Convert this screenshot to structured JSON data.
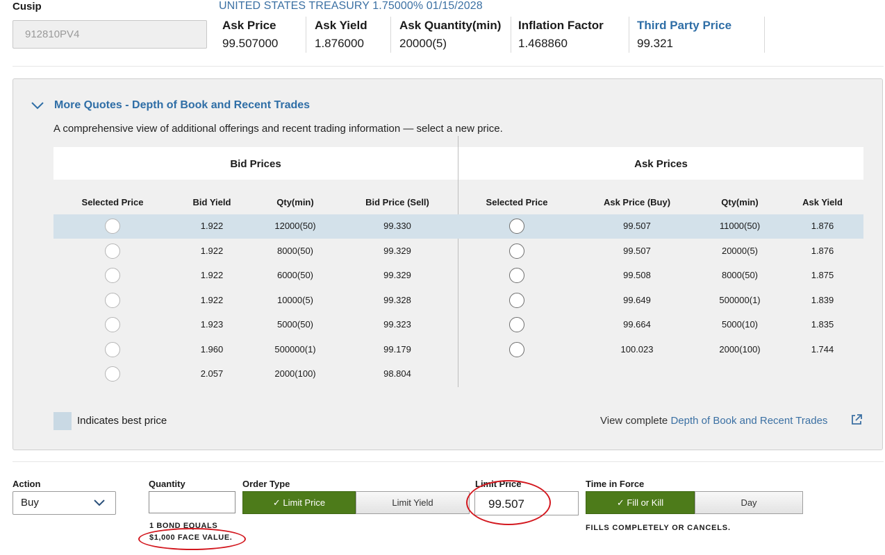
{
  "header": {
    "cusip_label": "Cusip",
    "cusip_value": "912810PV4",
    "security_title": "UNITED STATES TREASURY 1.75000% 01/15/2028",
    "quote_fields": [
      {
        "label": "Ask Price",
        "value": "99.507000"
      },
      {
        "label": "Ask Yield",
        "value": "1.876000"
      },
      {
        "label": "Ask Quantity(min)",
        "value": "20000(5)"
      },
      {
        "label": "Inflation Factor",
        "value": "1.468860"
      },
      {
        "label": "Third Party Price",
        "value": "99.321"
      }
    ]
  },
  "more_quotes": {
    "title": "More Quotes - Depth of Book and Recent Trades",
    "description": "A comprehensive view of additional offerings and recent trading information — select a new price.",
    "bid_group_label": "Bid Prices",
    "ask_group_label": "Ask Prices",
    "bid_columns": [
      "Selected Price",
      "Bid Yield",
      "Qty(min)",
      "Bid Price (Sell)"
    ],
    "ask_columns": [
      "Selected Price",
      "Ask Price (Buy)",
      "Qty(min)",
      "Ask Yield"
    ],
    "bid_rows": [
      {
        "yield": "1.922",
        "qty": "12000(50)",
        "price": "99.330"
      },
      {
        "yield": "1.922",
        "qty": "8000(50)",
        "price": "99.329"
      },
      {
        "yield": "1.922",
        "qty": "6000(50)",
        "price": "99.329"
      },
      {
        "yield": "1.922",
        "qty": "10000(5)",
        "price": "99.328"
      },
      {
        "yield": "1.923",
        "qty": "5000(50)",
        "price": "99.323"
      },
      {
        "yield": "1.960",
        "qty": "500000(1)",
        "price": "99.179"
      },
      {
        "yield": "2.057",
        "qty": "2000(100)",
        "price": "98.804"
      }
    ],
    "ask_rows": [
      {
        "price": "99.507",
        "qty": "11000(50)",
        "yield": "1.876"
      },
      {
        "price": "99.507",
        "qty": "20000(5)",
        "yield": "1.876"
      },
      {
        "price": "99.508",
        "qty": "8000(50)",
        "yield": "1.875"
      },
      {
        "price": "99.649",
        "qty": "500000(1)",
        "yield": "1.839"
      },
      {
        "price": "99.664",
        "qty": "5000(10)",
        "yield": "1.835"
      },
      {
        "price": "100.023",
        "qty": "2000(100)",
        "yield": "1.744"
      }
    ],
    "legend_text": "Indicates best price",
    "view_complete_prefix": "View complete ",
    "view_complete_link": "Depth of Book and Recent Trades"
  },
  "order": {
    "action_label": "Action",
    "action_value": "Buy",
    "quantity_label": "Quantity",
    "quantity_value": "",
    "quantity_note_line1": "1 BOND EQUALS",
    "quantity_note_line2": "$1,000 FACE VALUE.",
    "order_type_label": "Order Type",
    "order_type_options": [
      "Limit Price",
      "Limit Yield"
    ],
    "limit_price_label": "Limit Price",
    "limit_price_value": "99.507",
    "tif_label": "Time in Force",
    "tif_options": [
      "Fill or Kill",
      "Day"
    ],
    "tif_note": "FILLS COMPLETELY OR CANCELS."
  },
  "colors": {
    "link_blue": "#2f6ea6",
    "selected_green": "#4d7b1a",
    "best_price_row": "#d3e1ea",
    "annotation_red": "#d3181f"
  }
}
